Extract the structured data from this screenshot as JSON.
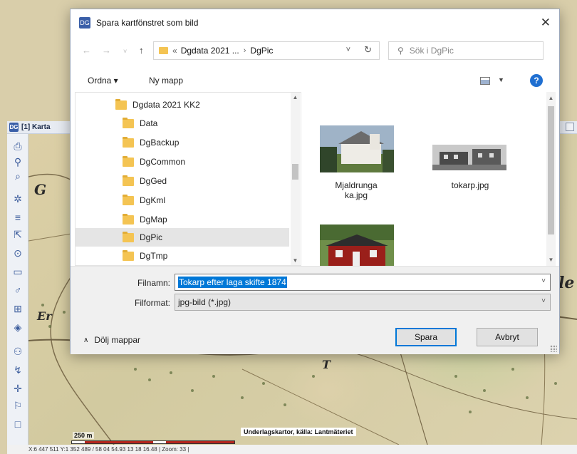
{
  "app": {
    "window_title": "[1] Karta",
    "logo_glyph": "DG",
    "status": "X:6 447 511 Y:1 352 489 / 58 04 54.93 13 18 16.48 | Zoom: 33 |",
    "scale_label": "250 m",
    "attribution": "Underlagskartor, källa: Lantmäteriet",
    "map_letters": [
      "G",
      "Er",
      "T",
      "le"
    ],
    "toolbar_icons": [
      "printer-icon",
      "find-person-icon",
      "search-icon",
      "settings-icon",
      "menu-icon",
      "pointer-icon",
      "zoom-icon",
      "ruler-icon",
      "pin-icon",
      "layers-tree-icon",
      "layers-icon",
      "person-icon",
      "route-icon",
      "crosshair-icon",
      "marker-icon",
      "frame-icon"
    ]
  },
  "dialog": {
    "title": "Spara kartfönstret som bild",
    "close_glyph": "✕",
    "nav": {
      "back": "←",
      "forward": "→",
      "recent": "˅",
      "up": "↑"
    },
    "breadcrumb": {
      "overflow": "«",
      "items": [
        "Dgdata 2021 ...",
        "DgPic"
      ],
      "separator": "›"
    },
    "search_placeholder": "Sök i DgPic",
    "commands": {
      "organize": "Ordna ▾",
      "new_folder": "Ny mapp",
      "help": "?"
    },
    "tree": [
      {
        "label": "Dgdata 2021 KK2",
        "selected": false
      },
      {
        "label": "Data",
        "selected": false
      },
      {
        "label": "DgBackup",
        "selected": false
      },
      {
        "label": "DgCommon",
        "selected": false
      },
      {
        "label": "DgGed",
        "selected": false
      },
      {
        "label": "DgKml",
        "selected": false
      },
      {
        "label": "DgMap",
        "selected": false
      },
      {
        "label": "DgPic",
        "selected": true
      },
      {
        "label": "DgTmp",
        "selected": false
      }
    ],
    "files": [
      {
        "name": "Mjaldrunga ka.jpg",
        "line1": "Mjaldrunga",
        "line2": "ka.jpg"
      },
      {
        "name": "tokarp.jpg",
        "line1": "tokarp.jpg",
        "line2": ""
      },
      {
        "name": "",
        "line1": "",
        "line2": ""
      }
    ],
    "filename_label": "Filnamn:",
    "filename_value": "Tokarp efter laga skifte 1874",
    "format_label": "Filformat:",
    "format_value": "jpg-bild (*.jpg)",
    "hide_folders": "Dölj mappar",
    "save": "Spara",
    "cancel": "Avbryt"
  }
}
